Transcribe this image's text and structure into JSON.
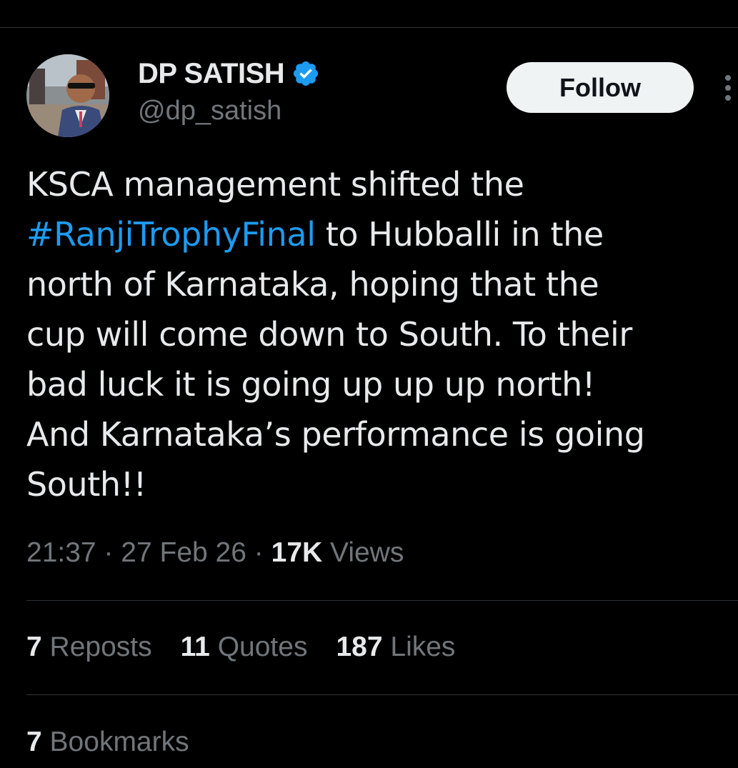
{
  "colors": {
    "background": "#000000",
    "primary_text": "#e7e9ea",
    "secondary_text": "#71767b",
    "link": "#1d9bf0",
    "verified_badge": "#1d9bf0",
    "follow_button_bg": "#eff3f4",
    "follow_button_text": "#0f1419",
    "divider": "#2f3336"
  },
  "author": {
    "display_name": "DP SATISH",
    "handle": "@dp_satish",
    "verified_icon": "verified-badge-icon",
    "avatar_icon": "profile-photo"
  },
  "header": {
    "follow_label": "Follow",
    "more_icon": "more-vertical-icon"
  },
  "tweet": {
    "lines": [
      {
        "text": "KSCA management shifted the"
      },
      {
        "hashtag": "#RanjiTrophyFinal",
        "text": " to Hubballi in the"
      },
      {
        "text": "north of Karnataka, hoping that the"
      },
      {
        "text": "cup will come down to South. To their"
      },
      {
        "text": "bad luck it is going up up up north!"
      },
      {
        "text": "And Karnataka’s performance is going"
      },
      {
        "text": "South!!"
      }
    ]
  },
  "meta": {
    "time": "21:37",
    "separator": "·",
    "date": "27 Feb 26",
    "views_count": "17K",
    "views_label": "Views"
  },
  "stats": {
    "reposts_count": "7",
    "reposts_label": "Reposts",
    "quotes_count": "11",
    "quotes_label": "Quotes",
    "likes_count": "187",
    "likes_label": "Likes",
    "bookmarks_count": "7",
    "bookmarks_label": "Bookmarks"
  }
}
